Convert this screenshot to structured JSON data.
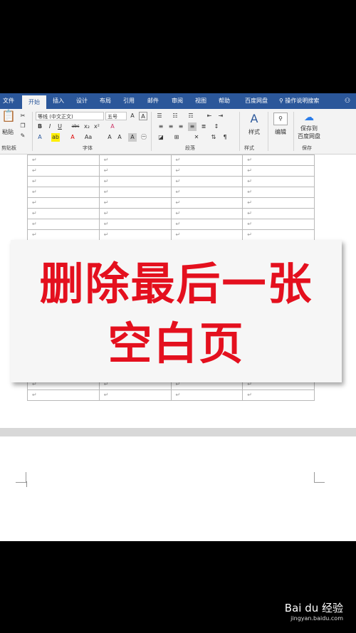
{
  "tabs": [
    "文件",
    "开始",
    "插入",
    "设计",
    "布局",
    "引用",
    "邮件",
    "审阅",
    "视图",
    "帮助",
    "百度网盘"
  ],
  "active_tab": "开始",
  "tell_me": "操作说明搜索",
  "ribbon": {
    "paste_label": "粘贴",
    "font_name": "等线 (中文正文)",
    "font_size": "五号",
    "styles_label": "样式",
    "edit_label": "编辑",
    "save_to_line1": "保存到",
    "save_to_line2": "百度网盘",
    "groups": {
      "clipboard": "剪贴板",
      "font": "字体",
      "paragraph": "段落",
      "styles": "样式",
      "save": "保存"
    }
  },
  "doc": {
    "cell_mark": "↵"
  },
  "overlay": {
    "line1": "删除最后一张",
    "line2": "空白页"
  },
  "watermark": {
    "brand": "Bai du 经验",
    "site": "jingyan.baidu.com"
  }
}
